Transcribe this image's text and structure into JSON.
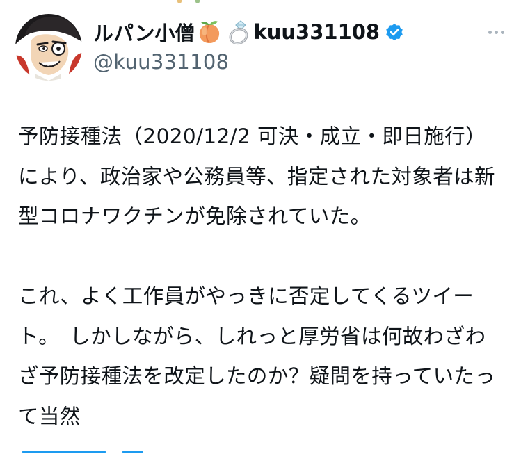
{
  "tweet": {
    "author": {
      "display_name": "ルパン小僧",
      "name_emojis": [
        "peach-emoji",
        "ring-emoji"
      ],
      "name_suffix": "kuu331108",
      "handle": "@kuu331108",
      "verified": true,
      "avatar_icon": "lupin-cartoon-avatar"
    },
    "more_menu_icon": "ellipsis-icon",
    "body": {
      "paragraph_1": "予防接種法（2020/12/2 可決・成立・即日施行）により、政治家や公務員等、指定された対象者は新型コロナワクチンが免除されていた。",
      "paragraph_2": "これ、よく工作員がやっきに否定してくるツイート。　しかしながら、しれっと厚労省は何故わざわざ予防接種法を改定したのか？疑問を持っていたって当然"
    }
  },
  "colors": {
    "text": "#0f1419",
    "secondary": "#536471",
    "verified_blue": "#1d9bf0"
  }
}
